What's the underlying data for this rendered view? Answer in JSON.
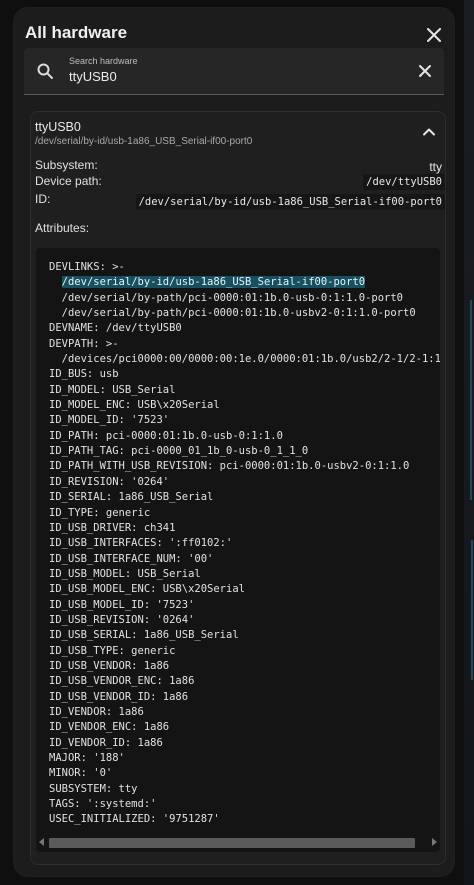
{
  "dialog": {
    "title": "All hardware"
  },
  "search": {
    "label": "Search hardware",
    "value": "ttyUSB0"
  },
  "device": {
    "name": "ttyUSB0",
    "path": "/dev/serial/by-id/usb-1a86_USB_Serial-if00-port0",
    "rows": {
      "subsystem_label": "Subsystem:",
      "subsystem_value": "tty",
      "device_path_label": "Device path:",
      "device_path_value": "/dev/ttyUSB0",
      "id_label": "ID:",
      "id_value": "/dev/serial/by-id/usb-1a86_USB_Serial-if00-port0"
    },
    "attributes_label": "Attributes:",
    "attributes_lines": [
      "DEVLINKS: >-",
      "  /dev/serial/by-id/usb-1a86_USB_Serial-if00-port0",
      "  /dev/serial/by-path/pci-0000:01:1b.0-usb-0:1:1.0-port0",
      "  /dev/serial/by-path/pci-0000:01:1b.0-usbv2-0:1:1.0-port0",
      "DEVNAME: /dev/ttyUSB0",
      "DEVPATH: >-",
      "  /devices/pci0000:00/0000:00:1e.0/0000:01:1b.0/usb2/2-1/2-1:1",
      "ID_BUS: usb",
      "ID_MODEL: USB_Serial",
      "ID_MODEL_ENC: USB\\x20Serial",
      "ID_MODEL_ID: '7523'",
      "ID_PATH: pci-0000:01:1b.0-usb-0:1:1.0",
      "ID_PATH_TAG: pci-0000_01_1b_0-usb-0_1_1_0",
      "ID_PATH_WITH_USB_REVISION: pci-0000:01:1b.0-usbv2-0:1:1.0",
      "ID_REVISION: '0264'",
      "ID_SERIAL: 1a86_USB_Serial",
      "ID_TYPE: generic",
      "ID_USB_DRIVER: ch341",
      "ID_USB_INTERFACES: ':ff0102:'",
      "ID_USB_INTERFACE_NUM: '00'",
      "ID_USB_MODEL: USB_Serial",
      "ID_USB_MODEL_ENC: USB\\x20Serial",
      "ID_USB_MODEL_ID: '7523'",
      "ID_USB_REVISION: '0264'",
      "ID_USB_SERIAL: 1a86_USB_Serial",
      "ID_USB_TYPE: generic",
      "ID_USB_VENDOR: 1a86",
      "ID_USB_VENDOR_ENC: 1a86",
      "ID_USB_VENDOR_ID: 1a86",
      "ID_VENDOR: 1a86",
      "ID_VENDOR_ENC: 1a86",
      "ID_VENDOR_ID: 1a86",
      "MAJOR: '188'",
      "MINOR: '0'",
      "SUBSYSTEM: tty",
      "TAGS: ':systemd:'",
      "USEC_INITIALIZED: '9751287'"
    ],
    "highlighted_line": 1
  },
  "icons": {
    "close": "close-icon",
    "search": "search-icon",
    "clear": "clear-icon",
    "collapse": "chevron-up-icon"
  },
  "colors": {
    "highlight": "#17505f"
  }
}
